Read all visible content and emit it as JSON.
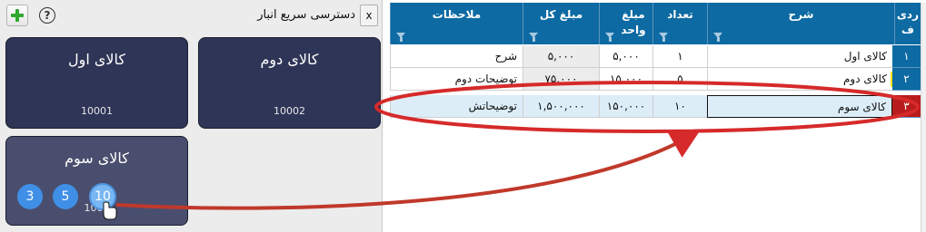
{
  "panel": {
    "title": "دسترسی سریع انبار",
    "close_label": "x",
    "help_label": "?",
    "add_icon": "plus-icon",
    "help_icon": "help-icon"
  },
  "tiles": [
    {
      "name": "کالای اول",
      "code": "10001"
    },
    {
      "name": "کالای دوم",
      "code": "10002"
    },
    {
      "name": "کالای سوم",
      "code": "1003"
    }
  ],
  "quantity_options": [
    "3",
    "5",
    "10"
  ],
  "grid": {
    "columns": [
      {
        "key": "row",
        "label": "ردی ف"
      },
      {
        "key": "desc",
        "label": "شرح"
      },
      {
        "key": "qty",
        "label": "تعداد"
      },
      {
        "key": "unit_price",
        "label": "مبلغ واحد"
      },
      {
        "key": "total",
        "label": "مبلغ کل"
      },
      {
        "key": "notes",
        "label": "ملاحظات"
      }
    ],
    "rows": [
      {
        "row": "۱",
        "desc": "کالای اول",
        "qty": "۱",
        "unit_price": "۵,۰۰۰",
        "total": "۵,۰۰۰",
        "notes": "شرح"
      },
      {
        "row": "۲",
        "desc": "کالای دوم",
        "qty": "۵",
        "unit_price": "۱۵,۰۰۰",
        "total": "۷۵,۰۰۰",
        "notes": "توضیحات دوم"
      },
      {
        "row": "۳",
        "desc": "کالای سوم",
        "qty": "۱۰",
        "unit_price": "۱۵۰,۰۰۰",
        "total": "۱,۵۰۰,۰۰۰",
        "notes": "توضیحاتش"
      }
    ]
  },
  "colors": {
    "tile_bg": "#2f3556",
    "header_bg": "#0d6aa3",
    "highlight_red": "#d62a2a",
    "selected_row_bg": "#dcedf7",
    "qty_circle": "#3f8fe6"
  }
}
